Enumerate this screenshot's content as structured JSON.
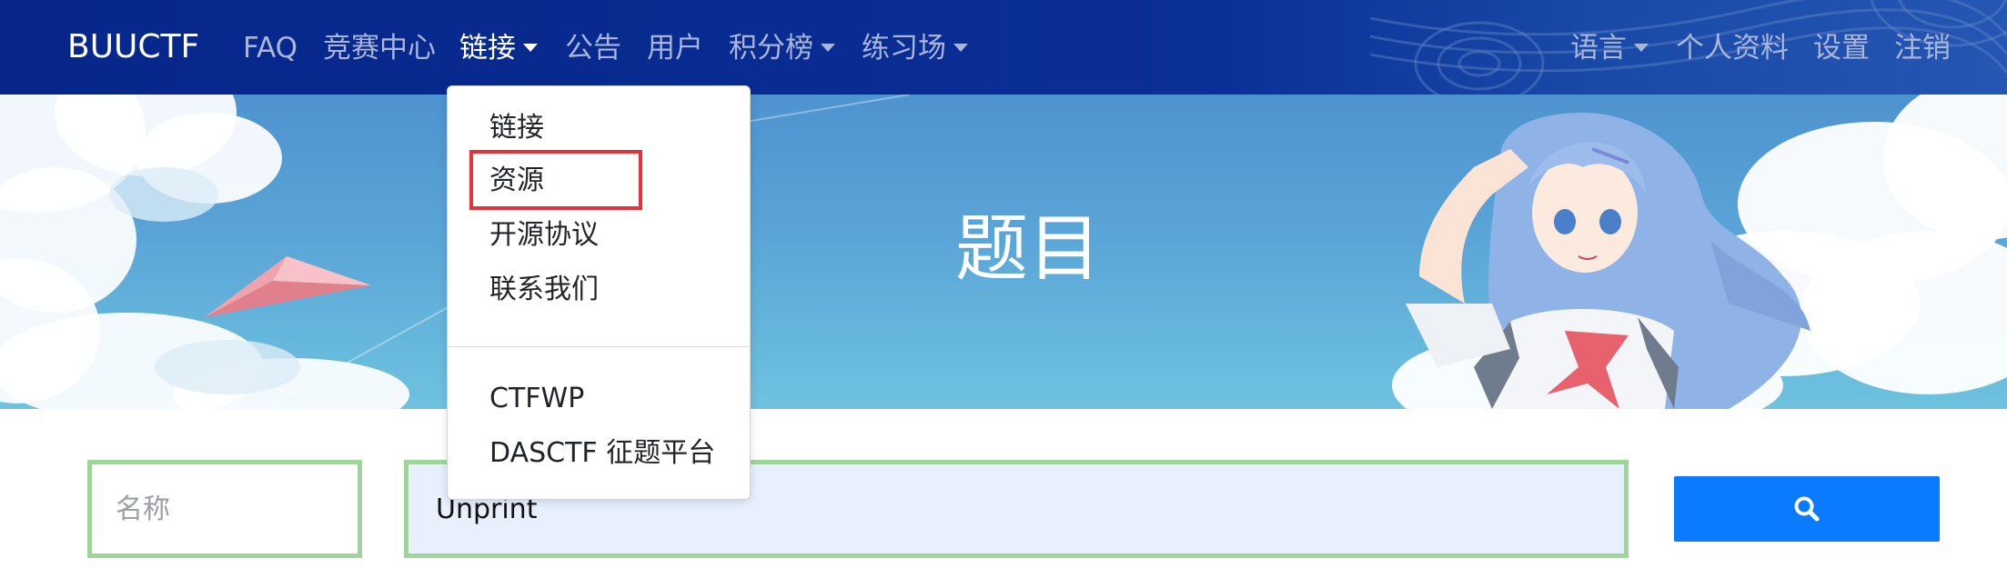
{
  "navbar": {
    "brand": "BUUCTF",
    "left_links": [
      {
        "label": "FAQ"
      },
      {
        "label": "竞赛中心"
      },
      {
        "label": "链接",
        "active": true,
        "dropdown": true
      },
      {
        "label": "公告"
      },
      {
        "label": "用户"
      },
      {
        "label": "积分榜",
        "dropdown": true
      },
      {
        "label": "练习场",
        "dropdown": true
      }
    ],
    "right_links": [
      {
        "label": "语言",
        "dropdown": true
      },
      {
        "label": "个人资料"
      },
      {
        "label": "设置"
      },
      {
        "label": "注销"
      }
    ],
    "colors": {
      "background": "#06268a",
      "link": "#a9b6da",
      "active_link": "#ffffff"
    }
  },
  "hero": {
    "title": "题目"
  },
  "dropdown_menu": {
    "items": [
      {
        "label": "链接"
      },
      {
        "label": "资源",
        "highlighted": true
      },
      {
        "label": "开源协议"
      },
      {
        "label": "联系我们"
      },
      {
        "label": "CTFWP"
      },
      {
        "label": "DASCTF 征题平台"
      }
    ],
    "highlight_color": "#e8323a"
  },
  "search": {
    "name_placeholder": "名称",
    "query_value": "Unprint",
    "button_icon": "search-icon",
    "button_color": "#0a7bff",
    "field_border_color": "#9fd49a"
  }
}
